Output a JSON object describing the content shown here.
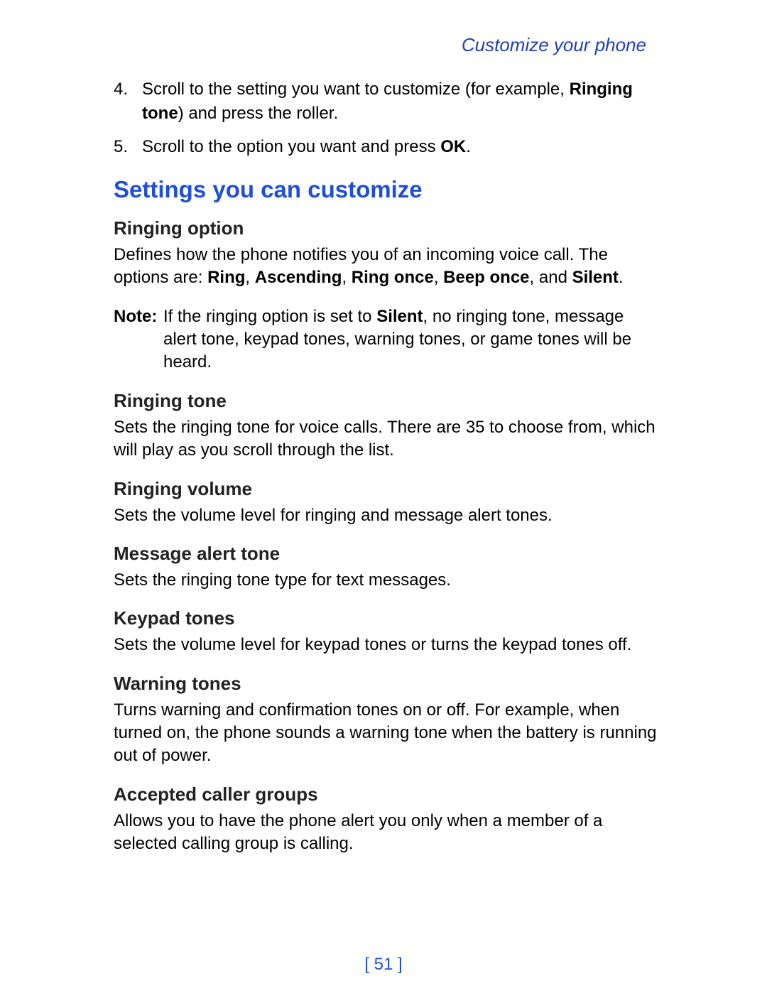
{
  "header": {
    "running_title": "Customize your phone"
  },
  "numbered_steps": [
    {
      "number": "4.",
      "prefix": "Scroll to the setting you want to customize (for example, ",
      "bold1": "Ringing tone",
      "suffix": ") and press the roller."
    },
    {
      "number": "5.",
      "prefix": "Scroll to the option you want and press ",
      "bold1": "OK",
      "suffix": "."
    }
  ],
  "section_heading": "Settings you can customize",
  "ringing_option": {
    "heading": "Ringing option",
    "text_prefix": "Defines how the phone notifies you of an incoming voice call. The options are:  ",
    "opts": [
      "Ring",
      "Ascending",
      "Ring once",
      "Beep once"
    ],
    "sep": ", ",
    "and": ", and ",
    "last_opt": "Silent",
    "period": "."
  },
  "note": {
    "label": "Note:",
    "prefix": "If the ringing option is set to ",
    "bold": "Silent",
    "suffix": ", no ringing tone, message alert tone, keypad tones, warning tones, or game tones will be heard."
  },
  "subsections": [
    {
      "heading": "Ringing tone",
      "body": "Sets the ringing tone for voice calls. There are 35 to choose from, which will play as you scroll through the list."
    },
    {
      "heading": "Ringing volume",
      "body": "Sets the volume level for ringing and message alert tones."
    },
    {
      "heading": "Message alert tone",
      "body": "Sets the ringing tone type for text messages."
    },
    {
      "heading": "Keypad tones",
      "body": "Sets the volume level for keypad tones or turns the keypad tones off."
    },
    {
      "heading": "Warning tones",
      "body": "Turns warning and confirmation tones on or off. For example, when turned on, the phone sounds a warning tone when the battery is running out of power."
    },
    {
      "heading": "Accepted caller groups",
      "body": "Allows you to have the phone alert you only when a member of a selected calling group is calling."
    }
  ],
  "page_number": "[ 51 ]"
}
